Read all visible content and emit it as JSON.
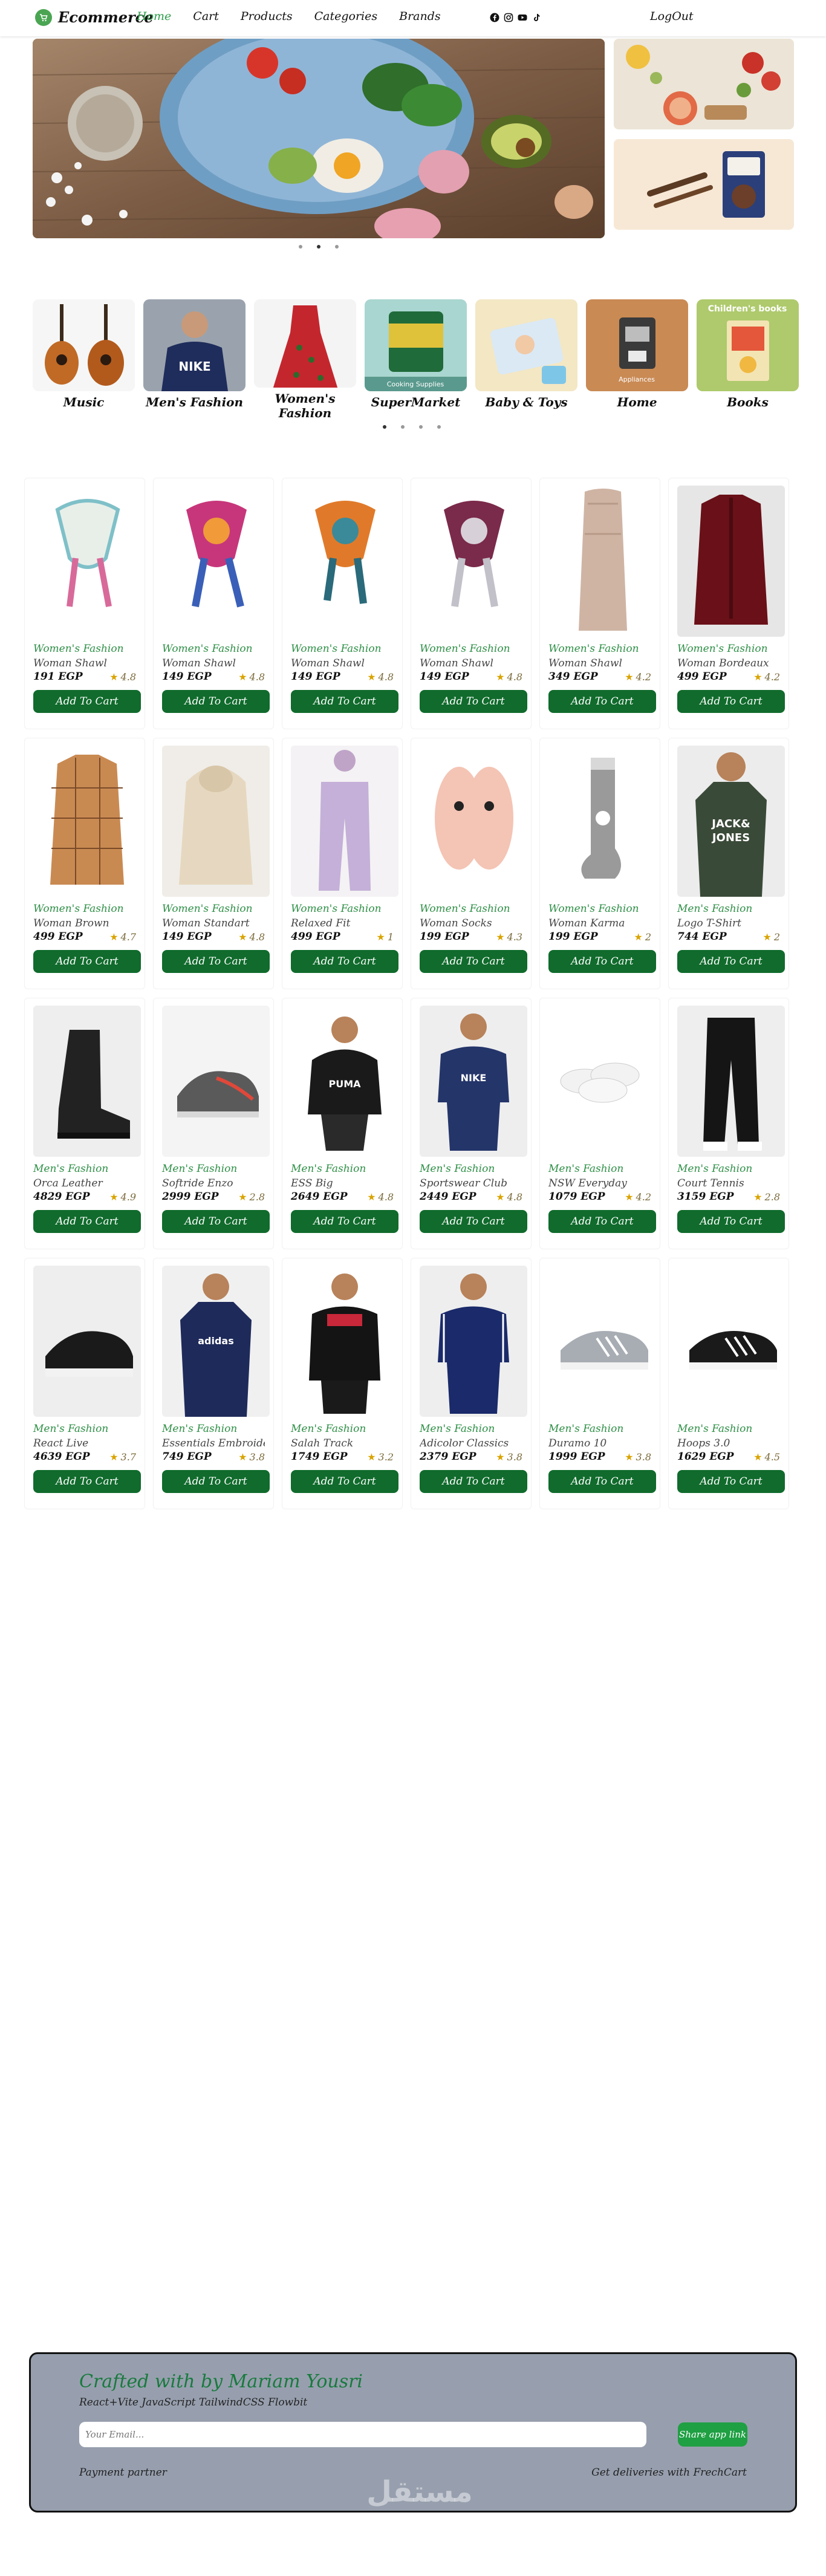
{
  "navbar": {
    "brand": "Ecommerce",
    "links": [
      "Home",
      "Cart",
      "Products",
      "Categories",
      "Brands"
    ],
    "active_link": "Home",
    "socials": [
      "facebook-icon",
      "instagram-icon",
      "youtube-icon",
      "tiktok-icon"
    ],
    "logout": "LogOut"
  },
  "hero": {
    "slides_dots": 3,
    "active_dot": 2
  },
  "categories": {
    "items": [
      {
        "name": "Music",
        "icon": "guitar"
      },
      {
        "name": "Men's Fashion",
        "icon": "hoodie"
      },
      {
        "name": "Women's Fashion",
        "icon": "dress"
      },
      {
        "name": "SuperMarket",
        "icon": "cooking-supplies",
        "caption": "Cooking Supplies"
      },
      {
        "name": "Baby & Toys",
        "icon": "diapers"
      },
      {
        "name": "Home",
        "icon": "appliances",
        "caption": "Appliances"
      },
      {
        "name": "Books",
        "icon": "book",
        "caption": "Children's books"
      }
    ],
    "dots": 4,
    "active_dot": 1
  },
  "products": [
    {
      "category": "Women's Fashion",
      "title": "Woman Shawl",
      "price": "191 EGP",
      "rating": "4.8",
      "img": "scarf-white"
    },
    {
      "category": "Women's Fashion",
      "title": "Woman Shawl",
      "price": "149 EGP",
      "rating": "4.8",
      "img": "scarf-pink"
    },
    {
      "category": "Women's Fashion",
      "title": "Woman Shawl",
      "price": "149 EGP",
      "rating": "4.8",
      "img": "scarf-orange"
    },
    {
      "category": "Women's Fashion",
      "title": "Woman Shawl",
      "price": "149 EGP",
      "rating": "4.8",
      "img": "scarf-purple"
    },
    {
      "category": "Women's Fashion",
      "title": "Woman Shawl",
      "price": "349 EGP",
      "rating": "4.2",
      "img": "long-scarf"
    },
    {
      "category": "Women's Fashion",
      "title": "Woman Bordeaux",
      "price": "499 EGP",
      "rating": "4.2",
      "img": "shirt-bordeaux"
    },
    {
      "category": "Women's Fashion",
      "title": "Woman Brown",
      "price": "499 EGP",
      "rating": "4.7",
      "img": "shirt-brown"
    },
    {
      "category": "Women's Fashion",
      "title": "Woman Standart",
      "price": "149 EGP",
      "rating": "4.8",
      "img": "hoodie-beige"
    },
    {
      "category": "Women's Fashion",
      "title": "Relaxed Fit",
      "price": "499 EGP",
      "rating": "1",
      "img": "pants-lilac"
    },
    {
      "category": "Women's Fashion",
      "title": "Woman Socks",
      "price": "199 EGP",
      "rating": "4.3",
      "img": "socks-pink"
    },
    {
      "category": "Women's Fashion",
      "title": "Woman Karma",
      "price": "199 EGP",
      "rating": "2",
      "img": "sock-grey"
    },
    {
      "category": "Men's Fashion",
      "title": "Logo T-Shirt",
      "price": "744 EGP",
      "rating": "2",
      "img": "tshirt-jackjones"
    },
    {
      "category": "Men's Fashion",
      "title": "Orca Leather",
      "price": "4829 EGP",
      "rating": "4.9",
      "img": "boot-black"
    },
    {
      "category": "Men's Fashion",
      "title": "Softride Enzo",
      "price": "2999 EGP",
      "rating": "2.8",
      "img": "shoe-grey"
    },
    {
      "category": "Men's Fashion",
      "title": "ESS Big",
      "price": "2649 EGP",
      "rating": "4.8",
      "img": "hoodie-puma"
    },
    {
      "category": "Men's Fashion",
      "title": "Sportswear Club",
      "price": "2449 EGP",
      "rating": "4.8",
      "img": "tracksuit-nike"
    },
    {
      "category": "Men's Fashion",
      "title": "NSW Everyday",
      "price": "1079 EGP",
      "rating": "4.2",
      "img": "socks-white"
    },
    {
      "category": "Men's Fashion",
      "title": "Court Tennis",
      "price": "3159 EGP",
      "rating": "2.8",
      "img": "pants-black"
    },
    {
      "category": "Men's Fashion",
      "title": "React Live",
      "price": "4639 EGP",
      "rating": "3.7",
      "img": "sneaker-black"
    },
    {
      "category": "Men's Fashion",
      "title": "Essentials Embroidered",
      "price": "749 EGP",
      "rating": "3.8",
      "img": "tshirt-adidas"
    },
    {
      "category": "Men's Fashion",
      "title": "Salah Track",
      "price": "1749 EGP",
      "rating": "3.2",
      "img": "jacket-track"
    },
    {
      "category": "Men's Fashion",
      "title": "Adicolor Classics",
      "price": "2379 EGP",
      "rating": "3.8",
      "img": "jacket-navy"
    },
    {
      "category": "Men's Fashion",
      "title": "Duramo 10",
      "price": "1999 EGP",
      "rating": "3.8",
      "img": "sneaker-grey"
    },
    {
      "category": "Men's Fashion",
      "title": "Hoops 3.0",
      "price": "1629 EGP",
      "rating": "4.5",
      "img": "sneaker-hoops"
    }
  ],
  "add_to_cart_label": "Add To Cart",
  "footer": {
    "title": "Crafted with by Mariam Yousri",
    "subtitle": "React+Vite JavaScript TailwindCSS Flowbit",
    "email_placeholder": "Your Email...",
    "share_button": "Share app link",
    "payment_partner": "Payment partner",
    "deliveries": "Get deliveries with FrechCart",
    "watermark": "مستقل"
  },
  "colors": {
    "accent_green": "#2e9e4b",
    "button_green": "#106b2c",
    "share_green": "#1fa043",
    "footer_bg": "#979fae",
    "star": "#d9a400"
  }
}
